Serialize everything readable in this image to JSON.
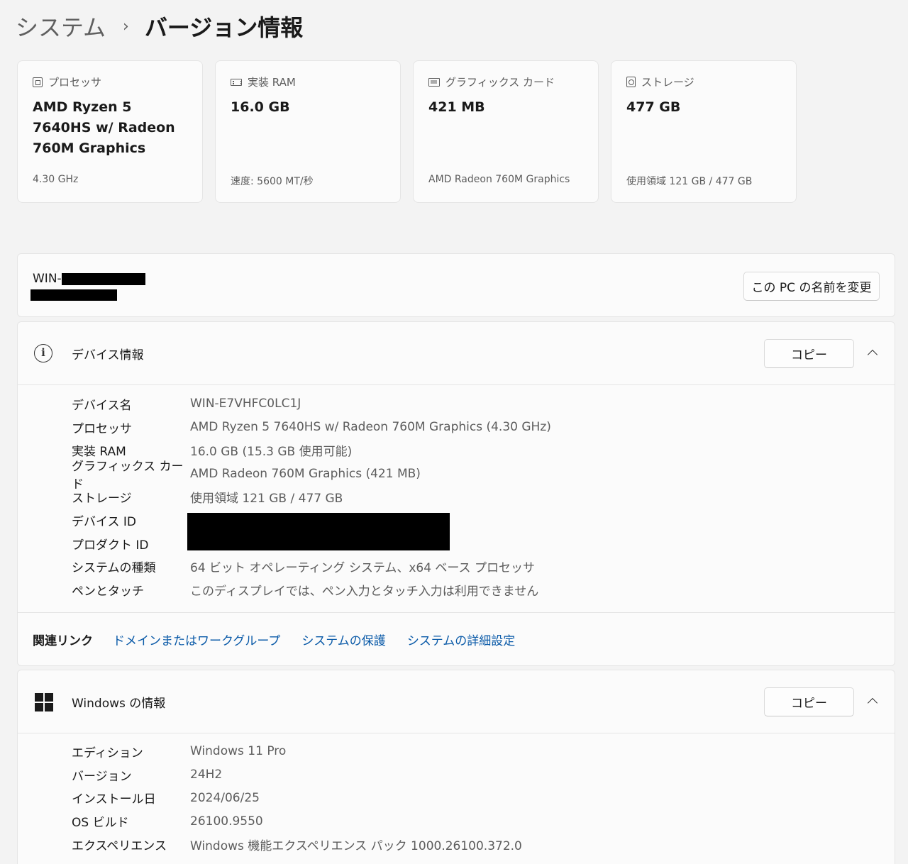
{
  "breadcrumb": {
    "parent": "システム",
    "separator": "›",
    "current": "バージョン情報"
  },
  "cards": [
    {
      "icon": "processor-icon",
      "title": "プロセッサ",
      "value": "AMD Ryzen 5 7640HS w/ Radeon 760M Graphics",
      "sub": "4.30 GHz"
    },
    {
      "icon": "ram-icon",
      "title": "実装 RAM",
      "value": "16.0 GB",
      "sub": "速度: 5600 MT/秒"
    },
    {
      "icon": "graphics-card-icon",
      "title": "グラフィックス カード",
      "value": "421 MB",
      "sub": "AMD Radeon 760M Graphics"
    },
    {
      "icon": "storage-icon",
      "title": "ストレージ",
      "value": "477 GB",
      "sub": "使用領域 121 GB / 477 GB"
    }
  ],
  "pc": {
    "name_prefix": "WIN-",
    "rename_label": "この PC の名前を変更"
  },
  "device_info": {
    "title": "デバイス情報",
    "copy_label": "コピー",
    "rows": [
      {
        "label": "デバイス名",
        "value": "WIN-E7VHFC0LC1J"
      },
      {
        "label": "プロセッサ",
        "value": "AMD Ryzen 5 7640HS w/ Radeon 760M Graphics (4.30 GHz)"
      },
      {
        "label": "実装 RAM",
        "value": "16.0 GB (15.3 GB 使用可能)"
      },
      {
        "label": "グラフィックス カード",
        "value": "AMD Radeon 760M Graphics (421 MB)"
      },
      {
        "label": "ストレージ",
        "value": "使用領域 121 GB / 477 GB"
      },
      {
        "label": "デバイス ID",
        "value": ""
      },
      {
        "label": "プロダクト ID",
        "value": ""
      },
      {
        "label": "システムの種類",
        "value": "64 ビット オペレーティング システム、x64 ベース プロセッサ"
      },
      {
        "label": "ペンとタッチ",
        "value": "このディスプレイでは、ペン入力とタッチ入力は利用できません"
      }
    ],
    "related_links_label": "関連リンク",
    "related_links": [
      "ドメインまたはワークグループ",
      "システムの保護",
      "システムの詳細設定"
    ]
  },
  "windows_info": {
    "title": "Windows の情報",
    "copy_label": "コピー",
    "rows": [
      {
        "label": "エディション",
        "value": "Windows 11 Pro"
      },
      {
        "label": "バージョン",
        "value": "24H2"
      },
      {
        "label": "インストール日",
        "value": "2024/06/25"
      },
      {
        "label": "OS ビルド",
        "value": "26100.9550"
      },
      {
        "label": "エクスペリエンス",
        "value": "Windows 機能エクスペリエンス パック 1000.26100.372.0"
      }
    ]
  }
}
